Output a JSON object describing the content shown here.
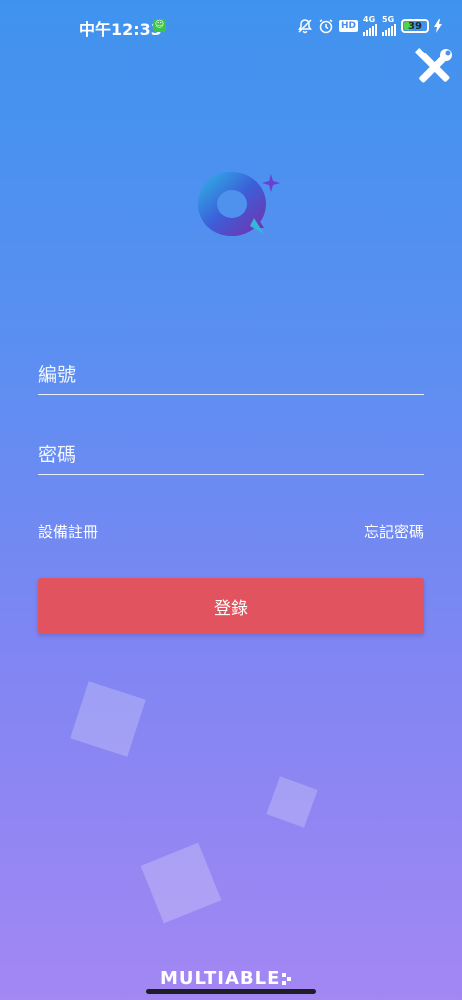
{
  "status_bar": {
    "time": "中午12:33",
    "net1": "4G",
    "net2": "5G",
    "hd": "HD",
    "battery": "39",
    "battery_level": 0.39
  },
  "logo": {
    "name": "app-logo"
  },
  "form": {
    "id_placeholder": "編號",
    "password_placeholder": "密碼",
    "register_label": "設備註冊",
    "forgot_label": "忘記密碼",
    "login_label": "登錄"
  },
  "footer": {
    "brand": "MULTIABLE"
  },
  "colors": {
    "login_button": "#e0535f",
    "background_top": "#3f93ee",
    "background_bottom": "#a387f3"
  }
}
